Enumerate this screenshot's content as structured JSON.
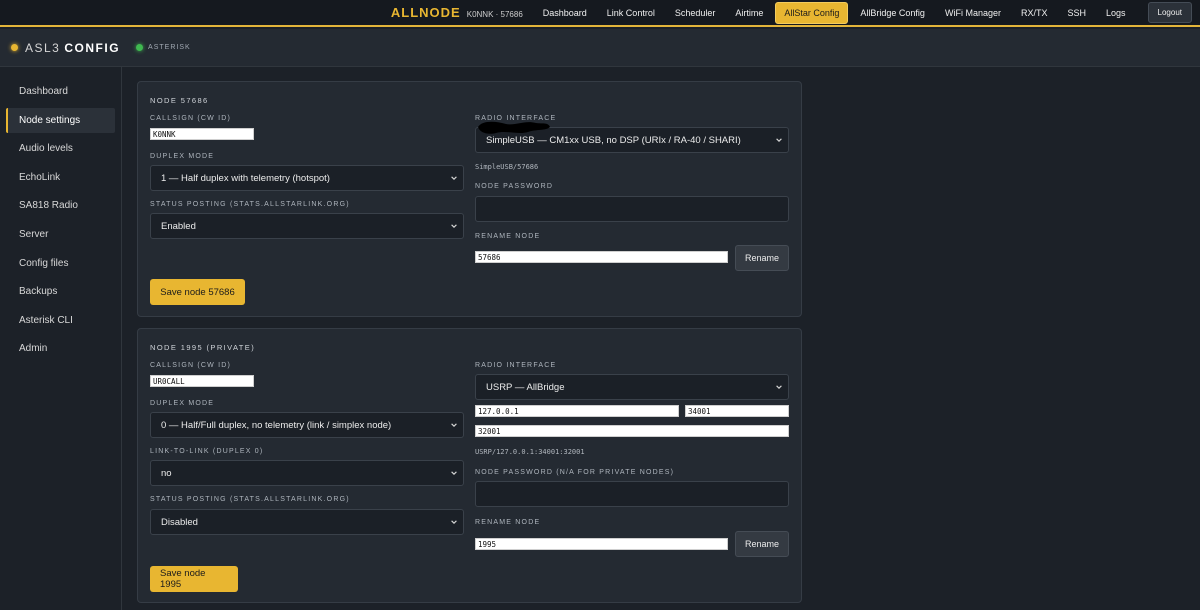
{
  "topnav": {
    "brand": "ALLNODE",
    "brand_sub": "K0NNK · 57686",
    "items": [
      {
        "label": "Dashboard",
        "active": false
      },
      {
        "label": "Link Control",
        "active": false
      },
      {
        "label": "Scheduler",
        "active": false
      },
      {
        "label": "Airtime",
        "active": false
      },
      {
        "label": "AllStar Config",
        "active": true
      },
      {
        "label": "AllBridge Config",
        "active": false
      },
      {
        "label": "WiFi Manager",
        "active": false
      },
      {
        "label": "RX/TX",
        "active": false
      },
      {
        "label": "SSH",
        "active": false
      },
      {
        "label": "Logs",
        "active": false
      }
    ],
    "logout": "Logout",
    "accent": "#e8b631"
  },
  "subheader": {
    "title_pre": "ASL3",
    "title_main": "CONFIG",
    "status": "ASTERISK"
  },
  "sidebar": {
    "items": [
      {
        "label": "Dashboard"
      },
      {
        "label": "Node settings",
        "active": true
      },
      {
        "label": "Audio levels"
      },
      {
        "label": "EchoLink"
      },
      {
        "label": "SA818 Radio"
      },
      {
        "label": "Server"
      },
      {
        "label": "Config files"
      },
      {
        "label": "Backups"
      },
      {
        "label": "Asterisk CLI"
      },
      {
        "label": "Admin"
      }
    ]
  },
  "node1": {
    "title": "NODE 57686",
    "callsign_label": "CALLSIGN (CW ID)",
    "callsign": "K0NNK",
    "duplex_label": "DUPLEX MODE",
    "duplex": "1 — Half duplex with telemetry (hotspot)",
    "status_label": "STATUS POSTING (STATS.ALLSTARLINK.ORG)",
    "status": "Enabled",
    "radio_label": "RADIO INTERFACE",
    "radio": "SimpleUSB — CM1xx USB, no DSP (URIx / RA-40 / SHARI)",
    "radio_note": "SimpleUSB/57686",
    "password_label": "NODE PASSWORD",
    "rename_label": "RENAME NODE",
    "rename_value": "57686",
    "rename_button": "Rename",
    "save_button": "Save node 57686"
  },
  "node2": {
    "title": "NODE 1995 (PRIVATE)",
    "callsign_label": "CALLSIGN (CW ID)",
    "callsign": "UR0CALL",
    "duplex_label": "DUPLEX MODE",
    "duplex": "0 — Half/Full duplex, no telemetry (link / simplex node)",
    "l2l_label": "LINK-TO-LINK (DUPLEX 0)",
    "l2l": "no",
    "status_label": "STATUS POSTING (STATS.ALLSTARLINK.ORG)",
    "status": "Disabled",
    "radio_label": "RADIO INTERFACE",
    "radio": "USRP — AllBridge",
    "usrp_ip": "127.0.0.1",
    "usrp_tx_port": "34001",
    "usrp_rx_port": "32001",
    "radio_note": "USRP/127.0.0.1:34001:32001",
    "password_label": "NODE PASSWORD (N/A FOR PRIVATE NODES)",
    "rename_label": "RENAME NODE",
    "rename_value": "1995",
    "rename_button": "Rename",
    "save_button": "Save node 1995"
  }
}
